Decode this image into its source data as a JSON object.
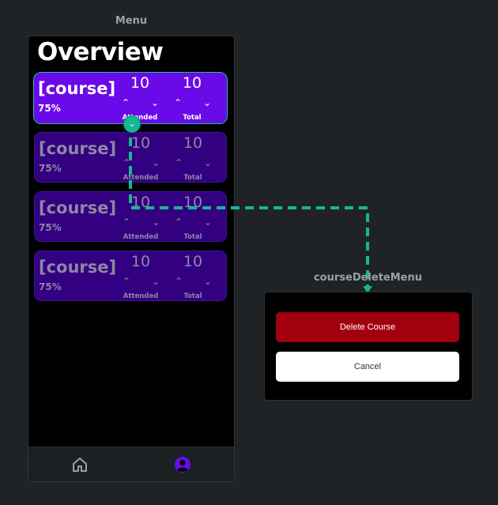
{
  "frames": {
    "menu_label": "Menu",
    "delete_menu_label": "courseDeleteMenu"
  },
  "screen": {
    "title": "Overview",
    "courses": [
      {
        "name": "[course]",
        "percent": "75%",
        "attended": "10",
        "total": "10",
        "attended_label": "Attended",
        "total_label": "Total",
        "state": "active"
      },
      {
        "name": "[course]",
        "percent": "75%",
        "attended": "10",
        "total": "10",
        "attended_label": "Attended",
        "total_label": "Total",
        "state": "dim"
      },
      {
        "name": "[course]",
        "percent": "75%",
        "attended": "10",
        "total": "10",
        "attended_label": "Attended",
        "total_label": "Total",
        "state": "dim"
      },
      {
        "name": "[course]",
        "percent": "75%",
        "attended": "10",
        "total": "10",
        "attended_label": "Attended",
        "total_label": "Total",
        "state": "dim"
      }
    ],
    "nav": [
      {
        "icon": "home-icon",
        "active": false
      },
      {
        "icon": "account-circle-icon",
        "active": true
      }
    ]
  },
  "delete_menu": {
    "delete_label": "Delete Course",
    "cancel_label": "Cancel"
  },
  "colors": {
    "accent": "#6a0ae8",
    "danger": "#a1000f",
    "connector": "#15b894"
  }
}
